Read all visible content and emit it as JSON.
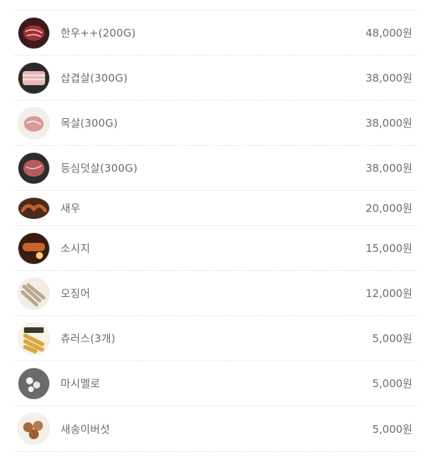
{
  "menu": {
    "items": [
      {
        "name": "한우++(200G)",
        "price": "48,000원",
        "image": "beef-icon",
        "color": "#8b2b2b"
      },
      {
        "name": "삽겹살(300G)",
        "price": "38,000원",
        "image": "pork-belly-icon",
        "color": "#c47a7a"
      },
      {
        "name": "목살(300G)",
        "price": "38,000원",
        "image": "pork-neck-icon",
        "color": "#c98a8a"
      },
      {
        "name": "등심덧살(300G)",
        "price": "38,000원",
        "image": "sirloin-icon",
        "color": "#a55050"
      },
      {
        "name": "새우",
        "price": "20,000원",
        "image": "shrimp-icon",
        "color": "#8a4a2a"
      },
      {
        "name": "소시지",
        "price": "15,000원",
        "image": "sausage-icon",
        "color": "#b0502a"
      },
      {
        "name": "오징어",
        "price": "12,000원",
        "image": "squid-icon",
        "color": "#d8cfc0"
      },
      {
        "name": "츄러스(3개)",
        "price": "5,000원",
        "image": "churros-icon",
        "color": "#d9a640"
      },
      {
        "name": "마시멜로",
        "price": "5,000원",
        "image": "marshmallow-icon",
        "color": "#7a7a7a"
      },
      {
        "name": "새송이버섯",
        "price": "5,000원",
        "image": "mushroom-icon",
        "color": "#a06a3a"
      }
    ]
  }
}
